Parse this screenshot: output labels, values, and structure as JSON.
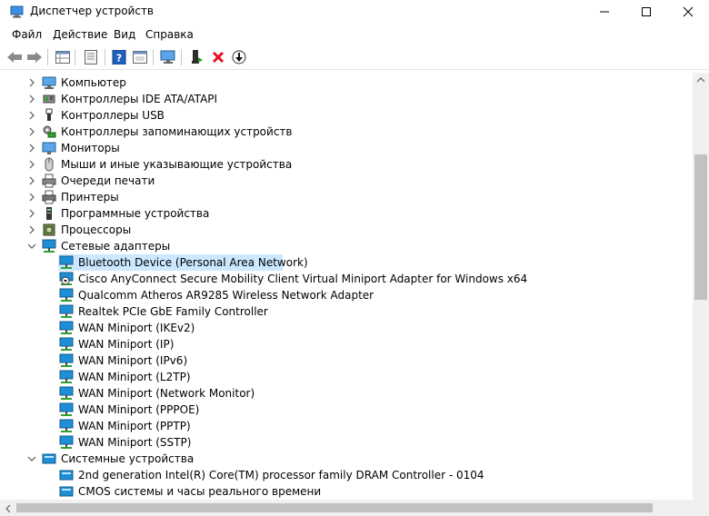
{
  "window": {
    "title": "Диспетчер устройств"
  },
  "menu": {
    "items": [
      "Файл",
      "Действие",
      "Вид",
      "Справка"
    ]
  },
  "toolbar": {
    "icons": [
      "back-icon",
      "forward-icon",
      "properties-grid-icon",
      "document-icon",
      "help-icon",
      "view-icon",
      "monitor-icon",
      "update-driver-icon",
      "uninstall-icon",
      "download-icon"
    ]
  },
  "tree": {
    "categories_top": [
      {
        "label": "Компьютер",
        "icon": "computer-icon"
      },
      {
        "label": "Контроллеры IDE ATA/ATAPI",
        "icon": "ide-controller-icon"
      },
      {
        "label": "Контроллеры USB",
        "icon": "usb-icon"
      },
      {
        "label": "Контроллеры запоминающих устройств",
        "icon": "storage-controller-icon"
      },
      {
        "label": "Мониторы",
        "icon": "monitor-icon"
      },
      {
        "label": "Мыши и иные указывающие устройства",
        "icon": "mouse-icon"
      },
      {
        "label": "Очереди печати",
        "icon": "print-queue-icon"
      },
      {
        "label": "Принтеры",
        "icon": "printer-icon"
      },
      {
        "label": "Программные устройства",
        "icon": "software-device-icon"
      },
      {
        "label": "Процессоры",
        "icon": "processor-icon"
      }
    ],
    "network": {
      "label": "Сетевые адаптеры",
      "children": [
        "Bluetooth Device (Personal Area Network)",
        "Cisco AnyConnect Secure Mobility Client Virtual Miniport Adapter for Windows x64",
        "Qualcomm Atheros AR9285 Wireless Network Adapter",
        "Realtek PCIe GbE Family Controller",
        "WAN Miniport (IKEv2)",
        "WAN Miniport (IP)",
        "WAN Miniport (IPv6)",
        "WAN Miniport (L2TP)",
        "WAN Miniport (Network Monitor)",
        "WAN Miniport (PPPOE)",
        "WAN Miniport (PPTP)",
        "WAN Miniport (SSTP)"
      ]
    },
    "system": {
      "label": "Системные устройства",
      "children": [
        "2nd generation Intel(R) Core(TM) processor family DRAM Controller - 0104",
        "CMOS системы и часы реального времени"
      ]
    }
  },
  "colors": {
    "selection": "#cce8ff",
    "net_icon": "#1e8fd6",
    "accent": "#0078d7"
  }
}
